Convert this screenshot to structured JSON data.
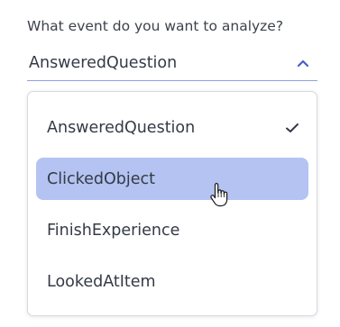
{
  "question": {
    "label": "What event do you want to analyze?"
  },
  "select": {
    "value": "AnsweredQuestion",
    "expanded": true,
    "toggle_icon": "chevron-up-icon",
    "accent_color": "#8ea1e3"
  },
  "dropdown": {
    "options": [
      {
        "label": "AnsweredQuestion",
        "selected": true,
        "highlighted": false
      },
      {
        "label": "ClickedObject",
        "selected": false,
        "highlighted": true
      },
      {
        "label": "FinishExperience",
        "selected": false,
        "highlighted": false
      },
      {
        "label": "LookedAtItem",
        "selected": false,
        "highlighted": false
      }
    ],
    "selected_marker_icon": "check-icon",
    "highlight_color": "#b4c3f1"
  },
  "cursor": {
    "icon": "hand-pointer-icon"
  }
}
